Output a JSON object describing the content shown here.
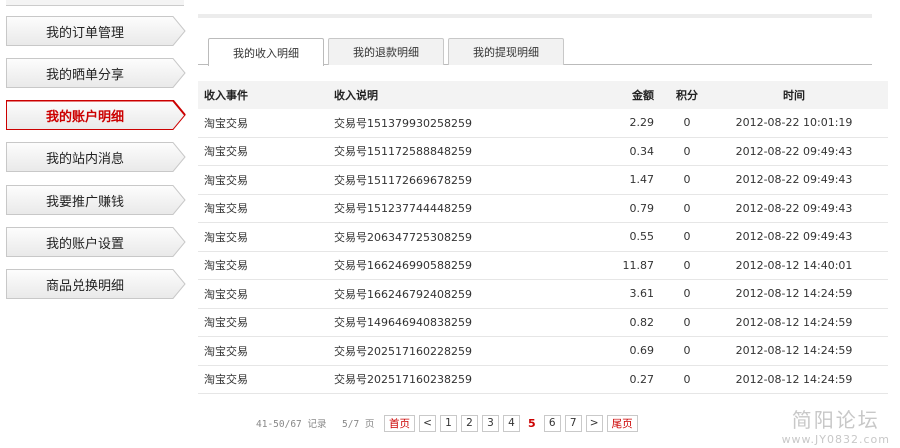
{
  "sidebar": {
    "items": [
      {
        "label": "我的订单管理"
      },
      {
        "label": "我的晒单分享"
      },
      {
        "label": "我的账户明细"
      },
      {
        "label": "我的站内消息"
      },
      {
        "label": "我要推广赚钱"
      },
      {
        "label": "我的账户设置"
      },
      {
        "label": "商品兑换明细"
      }
    ],
    "active_index": 2
  },
  "tabs": [
    {
      "label": "我的收入明细"
    },
    {
      "label": "我的退款明细"
    },
    {
      "label": "我的提现明细"
    }
  ],
  "table": {
    "headers": [
      "收入事件",
      "收入说明",
      "金额",
      "积分",
      "时间"
    ],
    "rows": [
      [
        "淘宝交易",
        "交易号151379930258259",
        "2.29",
        "0",
        "2012-08-22 10:01:19"
      ],
      [
        "淘宝交易",
        "交易号151172588848259",
        "0.34",
        "0",
        "2012-08-22 09:49:43"
      ],
      [
        "淘宝交易",
        "交易号151172669678259",
        "1.47",
        "0",
        "2012-08-22 09:49:43"
      ],
      [
        "淘宝交易",
        "交易号151237744448259",
        "0.79",
        "0",
        "2012-08-22 09:49:43"
      ],
      [
        "淘宝交易",
        "交易号206347725308259",
        "0.55",
        "0",
        "2012-08-22 09:49:43"
      ],
      [
        "淘宝交易",
        "交易号166246990588259",
        "11.87",
        "0",
        "2012-08-12 14:40:01"
      ],
      [
        "淘宝交易",
        "交易号166246792408259",
        "3.61",
        "0",
        "2012-08-12 14:24:59"
      ],
      [
        "淘宝交易",
        "交易号149646940838259",
        "0.82",
        "0",
        "2012-08-12 14:24:59"
      ],
      [
        "淘宝交易",
        "交易号202517160228259",
        "0.69",
        "0",
        "2012-08-12 14:24:59"
      ],
      [
        "淘宝交易",
        "交易号202517160238259",
        "0.27",
        "0",
        "2012-08-12 14:24:59"
      ]
    ]
  },
  "pager": {
    "records_text": "41-50/67 记录",
    "pages_text": "5/7 页",
    "first_label": "首页",
    "prev_label": "<",
    "pages_before": [
      "1",
      "2",
      "3",
      "4"
    ],
    "current": "5",
    "pages_after": [
      "6",
      "7"
    ],
    "next_label": ">",
    "last_label": "尾页"
  },
  "watermark": {
    "text": "简阳论坛",
    "url": "www.JY0832.com"
  },
  "colors": {
    "accent": "#cc0000",
    "tab_border": "#c8c8c8",
    "header_bg": "#f3f3f3",
    "row_border": "#e6e6e6"
  }
}
